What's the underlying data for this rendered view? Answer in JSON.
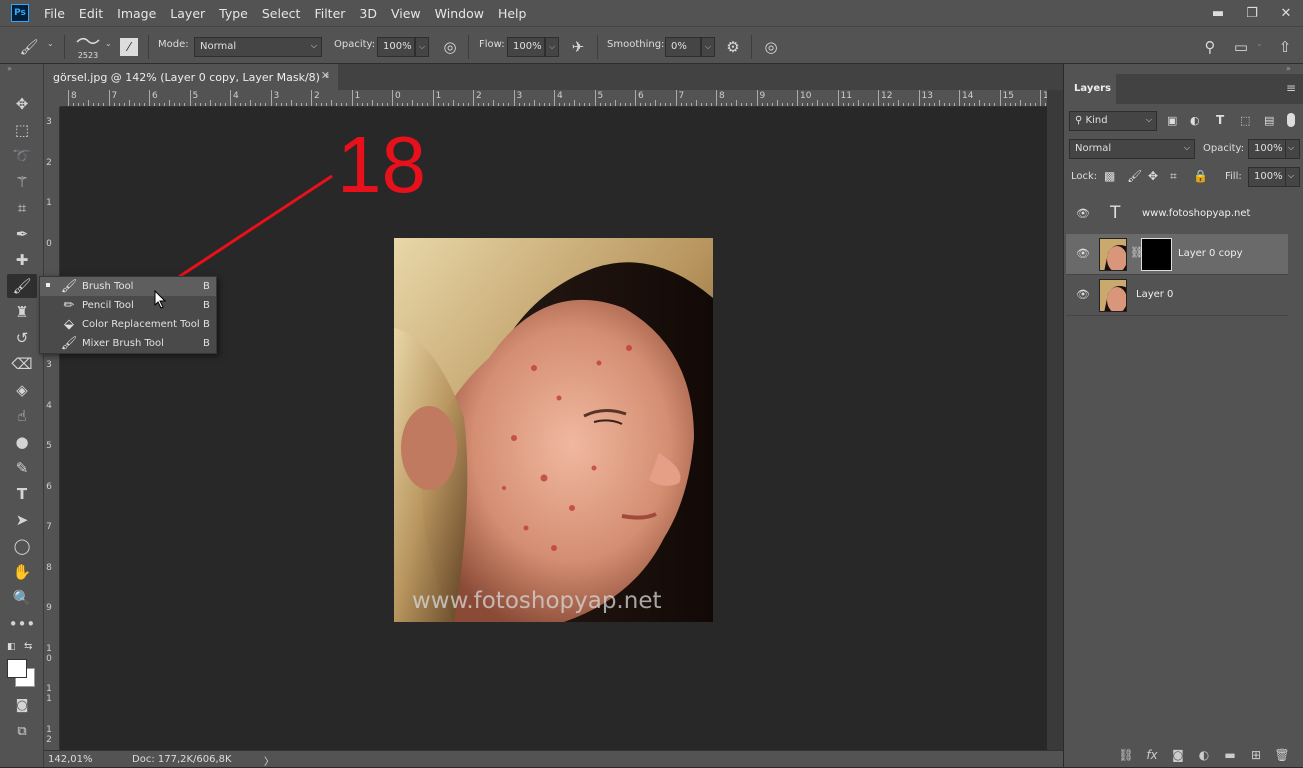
{
  "app": {
    "logo": "Ps"
  },
  "menu": [
    "File",
    "Edit",
    "Image",
    "Layer",
    "Type",
    "Select",
    "Filter",
    "3D",
    "View",
    "Window",
    "Help"
  ],
  "window_controls": {
    "minimize": "▬",
    "restore": "❐",
    "close": "✕"
  },
  "options": {
    "brush_size": "2523",
    "mode_label": "Mode:",
    "mode_value": "Normal",
    "opacity_label": "Opacity:",
    "opacity_value": "100%",
    "flow_label": "Flow:",
    "flow_value": "100%",
    "smoothing_label": "Smoothing:",
    "smoothing_value": "0%"
  },
  "document": {
    "tab_title": "görsel.jpg @ 142% (Layer 0 copy, Layer Mask/8) *",
    "tab_close": "✕",
    "ruler_top": [
      "8",
      "7",
      "6",
      "5",
      "4",
      "3",
      "2",
      "1",
      "0",
      "1",
      "2",
      "3",
      "4",
      "5",
      "6",
      "7",
      "8",
      "9",
      "10",
      "11",
      "12",
      "13",
      "14",
      "15",
      "1"
    ],
    "ruler_left": [
      "3",
      "2",
      "1",
      "0",
      "1",
      "2",
      "3",
      "4",
      "5",
      "6",
      "7",
      "8",
      "9",
      "10",
      "11",
      "12"
    ],
    "watermark": "www.fotoshopyap.net",
    "annotation": "18"
  },
  "status": {
    "zoom": "142,01%",
    "doc": "Doc: 177,2K/606,8K",
    "arrow": "〉"
  },
  "flyout": [
    {
      "label": "Brush Tool",
      "key": "B",
      "icon": "brush-icon",
      "selected": true
    },
    {
      "label": "Pencil Tool",
      "key": "B",
      "icon": "pencil-icon",
      "selected": false
    },
    {
      "label": "Color Replacement Tool",
      "key": "B",
      "icon": "color-replacement-icon",
      "selected": false
    },
    {
      "label": "Mixer Brush Tool",
      "key": "B",
      "icon": "mixer-brush-icon",
      "selected": false
    }
  ],
  "layers_panel": {
    "tab": "Layers",
    "kind_label": "Kind",
    "blend_mode": "Normal",
    "opacity_label": "Opacity:",
    "opacity_value": "100%",
    "lock_label": "Lock:",
    "fill_label": "Fill:",
    "fill_value": "100%",
    "layers": [
      {
        "name": "www.fotoshopyap.net",
        "type": "text",
        "selected": false
      },
      {
        "name": "Layer 0 copy",
        "type": "image-with-mask",
        "selected": true
      },
      {
        "name": "Layer 0",
        "type": "image",
        "selected": false
      }
    ]
  },
  "colors": {
    "annotation_red": "#e8101a",
    "panel_bg": "#535353",
    "canvas_bg": "#282828"
  }
}
